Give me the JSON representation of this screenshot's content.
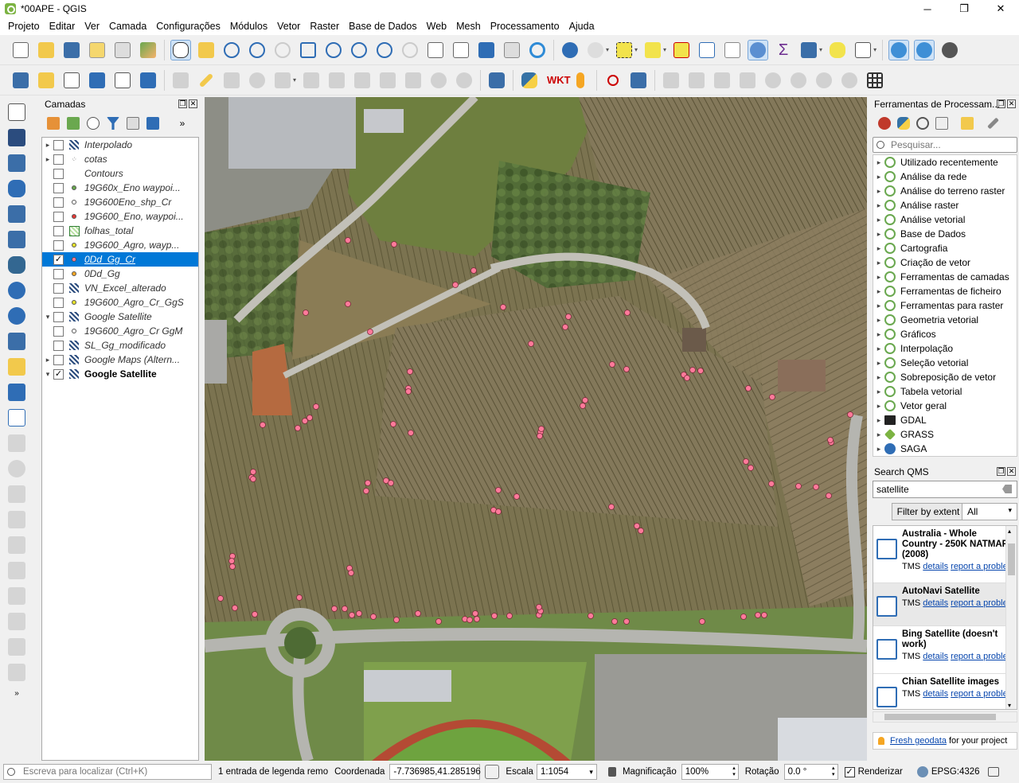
{
  "window": {
    "title": "*00APE - QGIS",
    "minimize": "─",
    "maximize": "❐",
    "close": "✕"
  },
  "menu": [
    "Projeto",
    "Editar",
    "Ver",
    "Camada",
    "Configurações",
    "Módulos",
    "Vetor",
    "Raster",
    "Base de Dados",
    "Web",
    "Mesh",
    "Processamento",
    "Ajuda"
  ],
  "layers_panel": {
    "title": "Camadas"
  },
  "layers": [
    {
      "name": "Interpolado",
      "arrow": "▸",
      "checked": false,
      "sym": "grid",
      "selected": false,
      "bold": false
    },
    {
      "name": "cotas",
      "arrow": "▸",
      "checked": false,
      "sym": "points-grey",
      "selected": false,
      "bold": false
    },
    {
      "name": "Contours",
      "arrow": "",
      "checked": false,
      "sym": "none",
      "selected": false,
      "bold": false
    },
    {
      "name": "19G60x_Eno waypoi...",
      "arrow": "",
      "checked": false,
      "sym": "dot-green",
      "selected": false,
      "bold": false
    },
    {
      "name": "19G600Eno_shp_Cr",
      "arrow": "",
      "checked": false,
      "sym": "dot-white",
      "selected": false,
      "bold": false
    },
    {
      "name": "19G600_Eno, waypoi...",
      "arrow": "",
      "checked": false,
      "sym": "dot-red",
      "selected": false,
      "bold": false
    },
    {
      "name": "folhas_total",
      "arrow": "",
      "checked": false,
      "sym": "poly-green",
      "selected": false,
      "bold": false
    },
    {
      "name": "19G600_Agro, wayp...",
      "arrow": "",
      "checked": false,
      "sym": "dot-yellow",
      "selected": false,
      "bold": false
    },
    {
      "name": "0Dd_Gg_Cr",
      "arrow": "",
      "checked": true,
      "sym": "dot-pink",
      "selected": true,
      "bold": false
    },
    {
      "name": "0Dd_Gg",
      "arrow": "",
      "checked": false,
      "sym": "dot-orange",
      "selected": false,
      "bold": false
    },
    {
      "name": "VN_Excel_alterado",
      "arrow": "",
      "checked": false,
      "sym": "grid",
      "selected": false,
      "bold": false
    },
    {
      "name": "19G600_Agro_Cr_GgS",
      "arrow": "",
      "checked": false,
      "sym": "dot-yellow",
      "selected": false,
      "bold": false
    },
    {
      "name": "Google Satellite",
      "arrow": "▾",
      "checked": false,
      "sym": "grid",
      "selected": false,
      "bold": false
    },
    {
      "name": "19G600_Agro_Cr GgM",
      "arrow": "",
      "checked": false,
      "sym": "dot-white",
      "selected": false,
      "bold": false
    },
    {
      "name": "SL_Gg_modificado",
      "arrow": "",
      "checked": false,
      "sym": "grid",
      "selected": false,
      "bold": false
    },
    {
      "name": "Google Maps (Altern...",
      "arrow": "▸",
      "checked": false,
      "sym": "grid",
      "selected": false,
      "bold": false
    },
    {
      "name": "Google Satellite",
      "arrow": "▾",
      "checked": true,
      "sym": "grid",
      "selected": false,
      "bold": true
    }
  ],
  "processing": {
    "title": "Ferramentas de Processam...",
    "search_placeholder": "Pesquisar...",
    "items": [
      {
        "label": "Utilizado recentemente",
        "icon": "q"
      },
      {
        "label": "Análise da rede",
        "icon": "q"
      },
      {
        "label": "Análise do terreno raster",
        "icon": "q"
      },
      {
        "label": "Análise raster",
        "icon": "q"
      },
      {
        "label": "Análise vetorial",
        "icon": "q"
      },
      {
        "label": "Base de Dados",
        "icon": "q"
      },
      {
        "label": "Cartografia",
        "icon": "q"
      },
      {
        "label": "Criação de vetor",
        "icon": "q"
      },
      {
        "label": "Ferramentas de camadas",
        "icon": "q"
      },
      {
        "label": "Ferramentas de ficheiro",
        "icon": "q"
      },
      {
        "label": "Ferramentas para raster",
        "icon": "q"
      },
      {
        "label": "Geometria vetorial",
        "icon": "q"
      },
      {
        "label": "Gráficos",
        "icon": "q"
      },
      {
        "label": "Interpolação",
        "icon": "q"
      },
      {
        "label": "Seleção vetorial",
        "icon": "q"
      },
      {
        "label": "Sobreposição de vetor",
        "icon": "q"
      },
      {
        "label": "Tabela vetorial",
        "icon": "q"
      },
      {
        "label": "Vetor geral",
        "icon": "q"
      },
      {
        "label": "GDAL",
        "icon": "gdal"
      },
      {
        "label": "GRASS",
        "icon": "grass"
      },
      {
        "label": "SAGA",
        "icon": "saga"
      }
    ]
  },
  "qms": {
    "title": "Search QMS",
    "query": "satellite",
    "filter_button": "Filter by extent",
    "scope": "All",
    "results": [
      {
        "title": "Australia - Whole Country - 250K NATMAP (2008)",
        "type": "TMS",
        "details": "details",
        "report": "report a proble"
      },
      {
        "title": "AutoNavi Satellite",
        "type": "TMS",
        "details": "details",
        "report": "report a proble"
      },
      {
        "title": "Bing Satellite (doesn't work)",
        "type": "TMS",
        "details": "details",
        "report": "report a proble"
      },
      {
        "title": "Chian Satellite images",
        "type": "TMS",
        "details": "details",
        "report": "report a proble"
      }
    ],
    "fresh_link": "Fresh geodata",
    "fresh_suffix": "for your project"
  },
  "status": {
    "locate_placeholder": "Escreva para localizar (Ctrl+K)",
    "legend_msg": "1 entrada de legenda remo",
    "coord_label": "Coordenada",
    "coord_value": "-7.736985,41.285196",
    "scale_label": "Escala",
    "scale_value": "1:1054",
    "magnifier_label": "Magnificação",
    "magnifier_value": "100%",
    "rotation_label": "Rotação",
    "rotation_value": "0.0 °",
    "render_label": "Renderizar",
    "crs": "EPSG:4326"
  },
  "colors": {
    "selection": "#0078d7",
    "points": "#ff7a9a",
    "field": "#7b7350",
    "road": "#b5b5b0"
  }
}
